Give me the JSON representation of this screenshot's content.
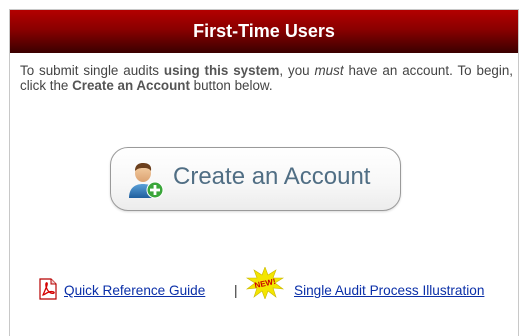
{
  "header": {
    "title": "First-Time Users"
  },
  "intro": {
    "p1": "To submit single audits ",
    "b1": "using this system",
    "p2": ", you ",
    "i1": "must",
    "p3": " have an account. To begin, click the ",
    "b2": "Create an Account",
    "p4": " button below."
  },
  "create_account": {
    "label": "Create an Account",
    "icon": "user-add-icon"
  },
  "links": {
    "quick_reference": {
      "label": "Quick Reference Guide",
      "icon": "pdf-icon"
    },
    "separator": "|",
    "new_badge": {
      "label": "NEW!",
      "icon": "new-burst-icon"
    },
    "single_audit": {
      "label": "Single Audit Process Illustration"
    }
  },
  "colors": {
    "header_top": "#b30000",
    "header_bottom": "#3a0000",
    "link": "#0a2fa8",
    "button_text": "#506e84"
  }
}
